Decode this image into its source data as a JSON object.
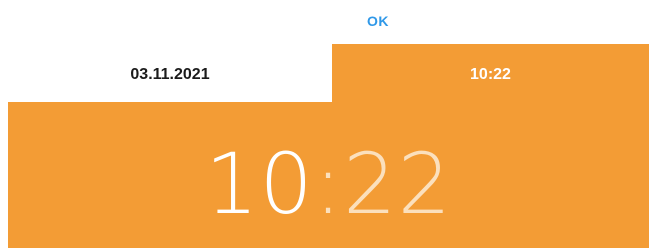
{
  "dialog": {
    "ok_label": "OK"
  },
  "tabs": {
    "date_label": "03.11.2021",
    "time_label": "10:22"
  },
  "time_display": {
    "hours": "10",
    "separator": ":",
    "minutes": "22"
  },
  "colors": {
    "accent": "#f39c35",
    "ok_text": "#2f98e8",
    "selected_text": "#ffffff",
    "unselected_text": "#fbe0bd"
  }
}
